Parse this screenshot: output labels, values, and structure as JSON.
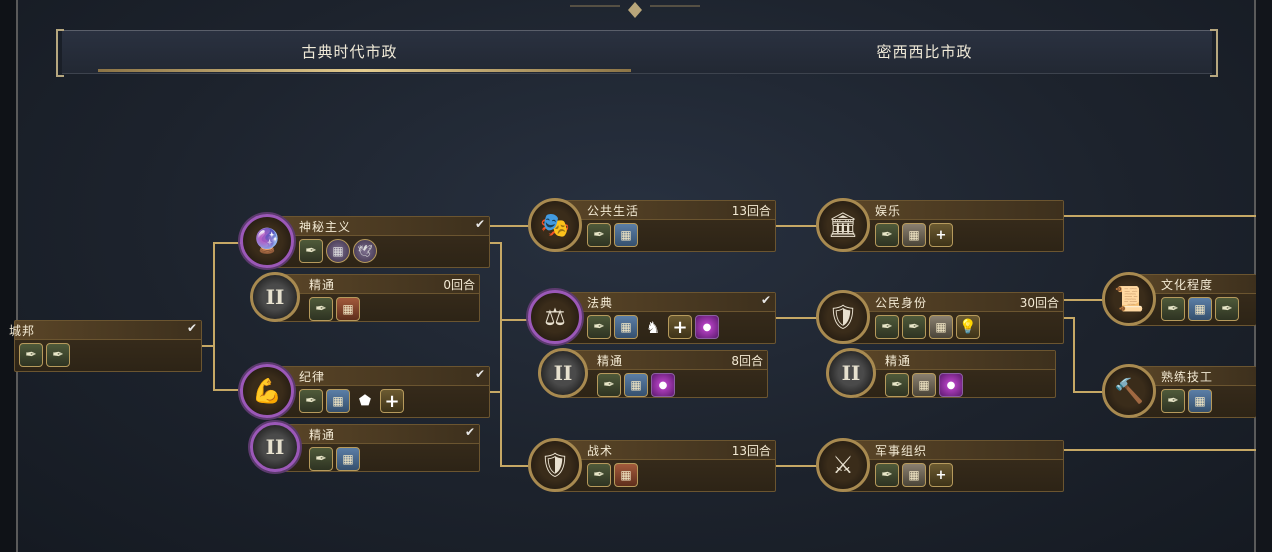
{
  "tabs": {
    "classical": "古典时代市政",
    "mississippian": "密西西比市政"
  },
  "nodes": {
    "city_state": {
      "name": "城邦",
      "check": "✔"
    },
    "mysticism": {
      "name": "神秘主义",
      "check": "✔"
    },
    "mysticism_mastery": {
      "name": "精通",
      "turns": "0回合",
      "roman": "II"
    },
    "discipline": {
      "name": "纪律",
      "check": "✔"
    },
    "discipline_mastery": {
      "name": "精通",
      "check": "✔",
      "roman": "II"
    },
    "public_life": {
      "name": "公共生活",
      "turns": "13回合"
    },
    "code_of_laws": {
      "name": "法典",
      "check": "✔"
    },
    "code_mastery": {
      "name": "精通",
      "turns": "8回合",
      "roman": "II"
    },
    "tactics": {
      "name": "战术",
      "turns": "13回合"
    },
    "entertainment": {
      "name": "娱乐"
    },
    "citizenship": {
      "name": "公民身份",
      "turns": "30回合"
    },
    "citizenship_mastery": {
      "name": "精通",
      "roman": "II"
    },
    "military_organization": {
      "name": "军事组织"
    },
    "literacy": {
      "name": "文化程度"
    },
    "skilled_trades": {
      "name": "熟练技工"
    }
  },
  "icons": {
    "quill": "✒",
    "building": "▦",
    "plus": "+",
    "dove": "🕊",
    "badge": "⬟",
    "bulb": "💡"
  },
  "colors": {
    "gold_border": "#a88a50",
    "purple_border": "#9b58b8",
    "card_bg": "#2d2416",
    "line": "#c6a865"
  }
}
